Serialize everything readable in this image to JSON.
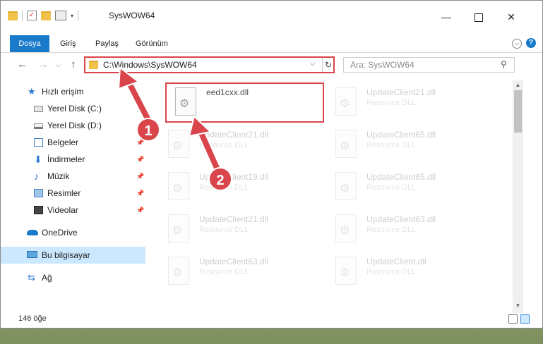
{
  "window": {
    "title": "SysWOW64",
    "controls": {
      "minimize": "—",
      "maximize": "",
      "close": "✕"
    }
  },
  "ribbon": {
    "tabs": [
      "Dosya",
      "Giriş",
      "Paylaş",
      "Görünüm"
    ]
  },
  "nav": {
    "back": "←",
    "forward": "→",
    "recent": "⌵",
    "up": "↑",
    "address": "C:\\Windows\\SysWOW64",
    "address_chevron": "⌵",
    "refresh": "↻",
    "search_placeholder": "Ara: SysWOW64",
    "search_icon": "⚲"
  },
  "sidebar": {
    "items": [
      {
        "label": "Hızlı erişim",
        "icon": "star-icon"
      },
      {
        "label": "Yerel Disk (C:)",
        "icon": "drive-icon",
        "pinned": true
      },
      {
        "label": "Yerel Disk (D:)",
        "icon": "drive-icon",
        "pinned": true
      },
      {
        "label": "Belgeler",
        "icon": "documents-icon",
        "pinned": true
      },
      {
        "label": "İndirmeler",
        "icon": "download-icon",
        "pinned": true
      },
      {
        "label": "Müzik",
        "icon": "music-icon",
        "pinned": true
      },
      {
        "label": "Resimler",
        "icon": "pictures-icon",
        "pinned": true
      },
      {
        "label": "Videolar",
        "icon": "videos-icon",
        "pinned": true
      },
      {
        "label": "OneDrive",
        "icon": "cloud-icon"
      },
      {
        "label": "Bu bilgisayar",
        "icon": "computer-icon",
        "selected": true
      },
      {
        "label": "Ağ",
        "icon": "network-icon"
      }
    ],
    "pin_glyph": "📌",
    "star_glyph": "★",
    "download_glyph": "⬇",
    "music_glyph": "♪",
    "net_glyph": "⇆"
  },
  "files": [
    {
      "name": "eed1cxx.dll",
      "type": "",
      "highlight": true
    },
    {
      "name": "UpdateClient21.dll",
      "type": "Resource DLL"
    },
    {
      "name": "UpdateClient21.dll",
      "type": "Resource DLL"
    },
    {
      "name": "UpdateClient65.dll",
      "type": "Resource DLL"
    },
    {
      "name": "UpdateClient19.dll",
      "type": "Resource DLL"
    },
    {
      "name": "UpdateClient65.dll",
      "type": "Resource DLL"
    },
    {
      "name": "UpdateClient21.dll",
      "type": "Resource DLL"
    },
    {
      "name": "UpdateClient63.dll",
      "type": "Resource DLL"
    },
    {
      "name": "UpdateClient63.dll",
      "type": "Resource DLL"
    },
    {
      "name": "UpdateClient.dll",
      "type": "Resource DLL"
    }
  ],
  "status": {
    "count": "146 öğe"
  },
  "annotations": {
    "step1": "1",
    "step2": "2",
    "accent": "#d9454a"
  },
  "scroll": {
    "up": "▲",
    "down": "▼"
  }
}
